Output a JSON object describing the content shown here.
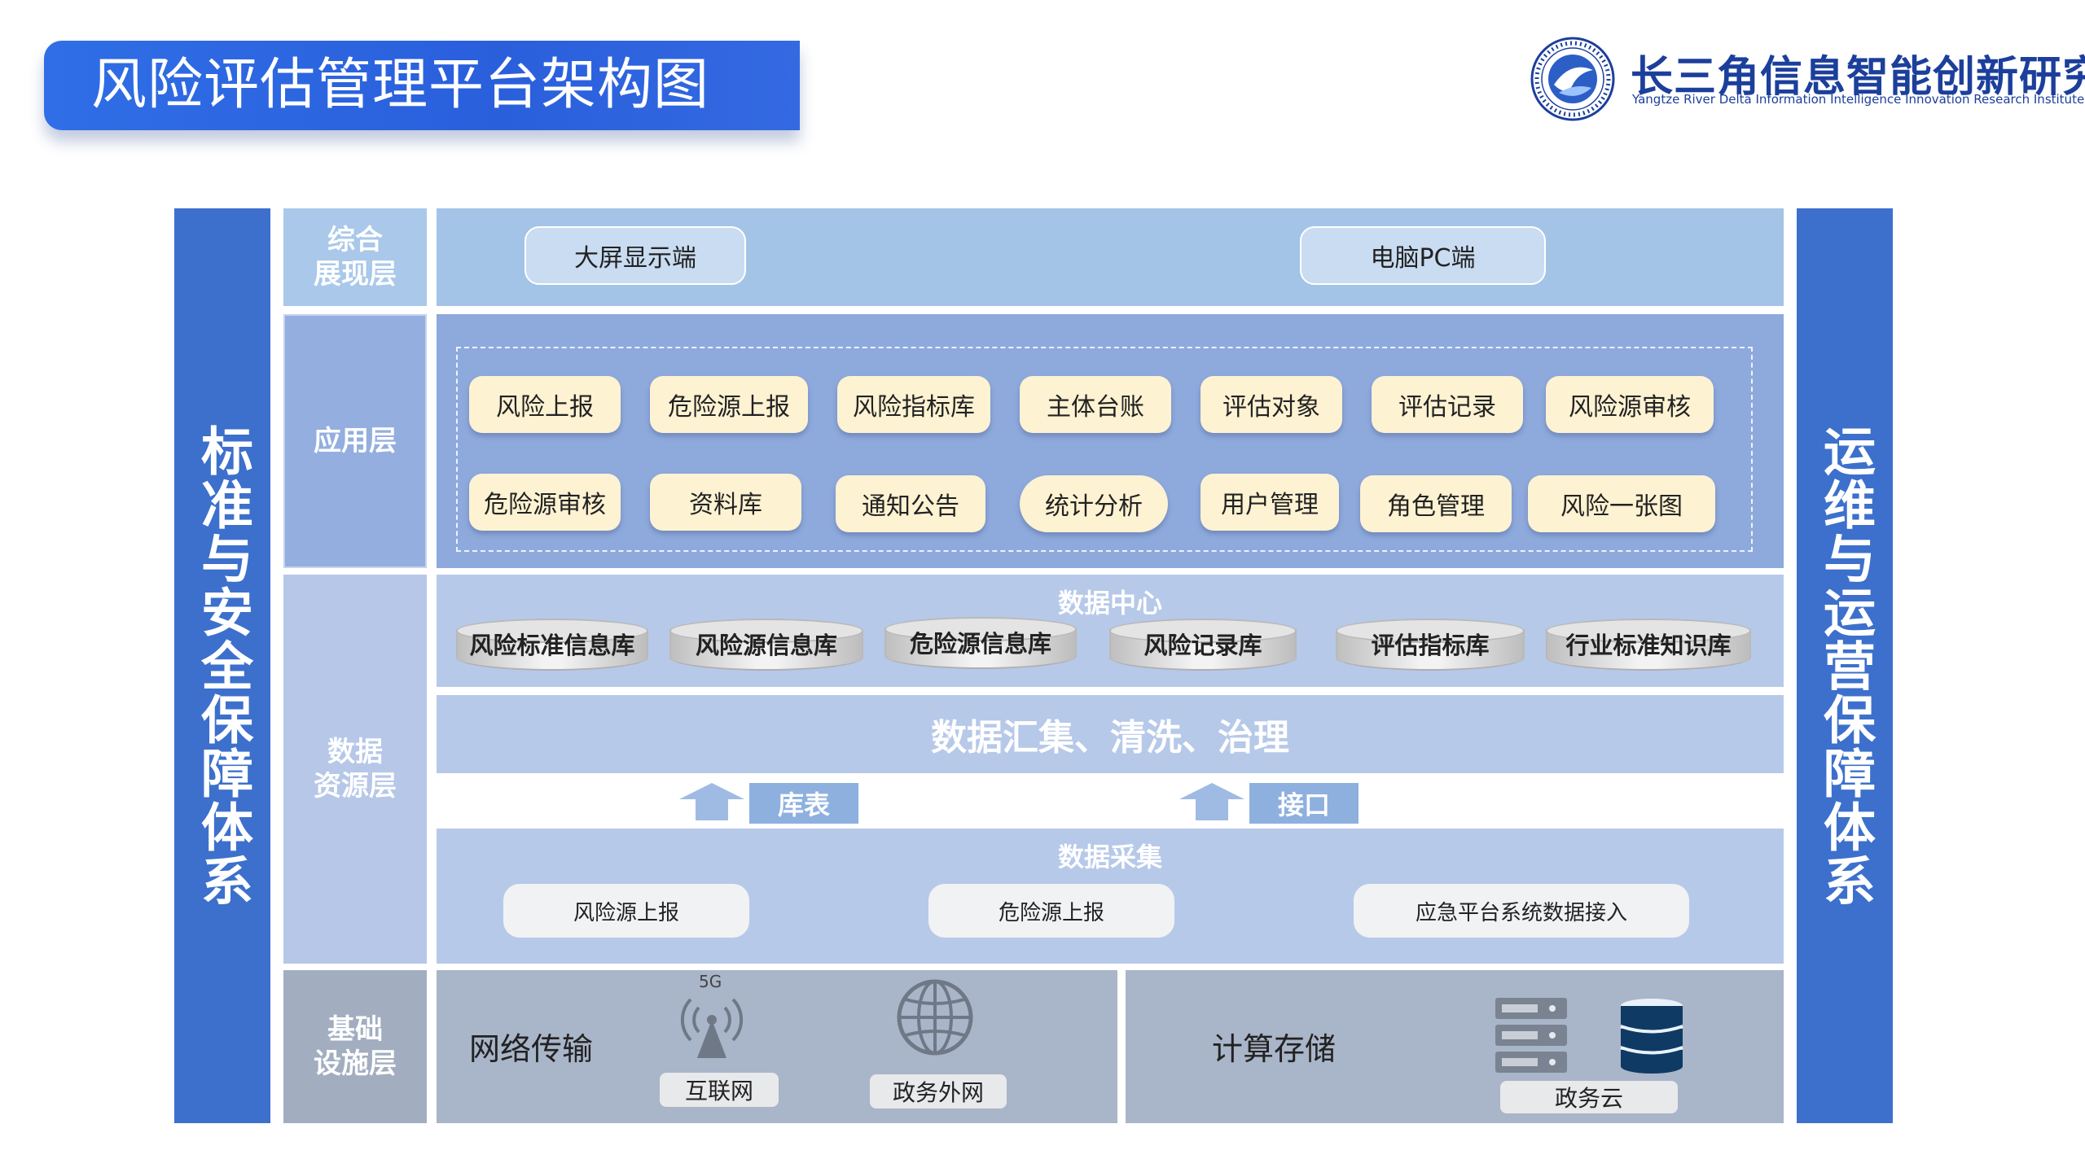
{
  "title": "风险评估管理平台架构图",
  "logo": {
    "name_cn": "长三角信息智能创新研究院",
    "name_en": "Yangtze River Delta Information Intelligence Innovation Research Institute"
  },
  "pillars": {
    "left": "标准与安全保障体系",
    "right": "运维与运营保障体系"
  },
  "layers": {
    "presentation": {
      "label": "综合\n展现层",
      "items": [
        "大屏显示端",
        "电脑PC端"
      ]
    },
    "application": {
      "label": "应用层",
      "row1": [
        "风险上报",
        "危险源上报",
        "风险指标库",
        "主体台账",
        "评估对象",
        "评估记录",
        "风险源审核"
      ],
      "row2": [
        "危险源审核",
        "资料库",
        "通知公告",
        "统计分析",
        "用户管理",
        "角色管理",
        "风险一张图"
      ]
    },
    "data": {
      "label": "数据\n资源层",
      "center_title": "数据中心",
      "databases": [
        "风险标准信息库",
        "风险源信息库",
        "危险源信息库",
        "风险记录库",
        "评估指标库",
        "行业标准知识库"
      ],
      "processing": "数据汇集、清洗、治理",
      "arrows": [
        "库表",
        "接口"
      ],
      "collection_title": "数据采集",
      "collection_items": [
        "风险源上报",
        "危险源上报",
        "应急平台系统数据接入"
      ]
    },
    "infrastructure": {
      "label": "基础\n设施层",
      "network_title": "网络传输",
      "network_5g": "5G",
      "network_items": [
        "互联网",
        "政务外网"
      ],
      "compute_title": "计算存储",
      "compute_items": [
        "政务云"
      ]
    }
  },
  "colors": {
    "title_blue": "#2f6ee6",
    "pillar_blue": "#3c70cc",
    "presentation_bg": "#a3c4e7",
    "application_bg": "#8ea9dc",
    "data_bg": "#b7c9e9",
    "infra_bg": "#a9b5c8",
    "label_presentation": "#a9c8ea",
    "label_application": "#94aee0",
    "label_data": "#b6c7e8",
    "label_infra": "#a2aec0"
  }
}
